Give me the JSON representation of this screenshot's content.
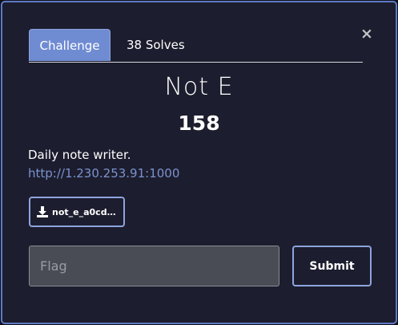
{
  "modal": {
    "close_label": "×",
    "tabs": [
      {
        "label": "Challenge",
        "active": true
      },
      {
        "label": "38 Solves",
        "active": false
      }
    ],
    "challenge": {
      "name": "Not E",
      "points": "158",
      "description": "Daily note writer.",
      "link": "http://1.230.253.91:1000",
      "file": {
        "label": "not_e_a0cd…",
        "icon": "download-icon"
      }
    },
    "flag": {
      "placeholder": "Flag",
      "value": ""
    },
    "submit_label": "Submit"
  },
  "colors": {
    "background": "#1c1d2e",
    "accent": "#6f8bd2",
    "border": "#8ea4df",
    "link": "#7b93cf"
  }
}
